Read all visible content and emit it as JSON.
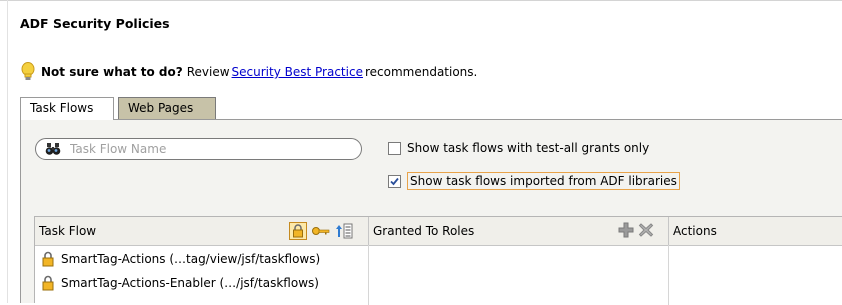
{
  "title": "ADF Security Policies",
  "hint": {
    "bold": "Not sure what to do?",
    "pre": "Review",
    "link": "Security Best Practice",
    "post": "recommendations.",
    "icon": "lightbulb-icon"
  },
  "tabs": [
    {
      "label": "Task Flows",
      "selected": true
    },
    {
      "label": "Web Pages",
      "selected": false
    }
  ],
  "search": {
    "placeholder": "Task Flow Name",
    "value": "",
    "icon": "binoculars-icon"
  },
  "checkboxes": [
    {
      "label": "Show task flows with test-all grants only",
      "checked": false
    },
    {
      "label": "Show task flows imported from ADF libraries",
      "checked": true
    }
  ],
  "table": {
    "columns": [
      "Task Flow",
      "Granted To Roles",
      "Actions"
    ],
    "header_icons_col1": [
      "lock-filter-icon",
      "key-filter-icon",
      "sort-icon"
    ],
    "header_icons_col2": [
      "add-icon",
      "delete-icon"
    ],
    "rows": [
      {
        "name": "SmartTag-Actions (…tag/view/jsf/taskflows)",
        "icon": "lock-icon"
      },
      {
        "name": "SmartTag-Actions-Enabler (…/jsf/taskflows)",
        "icon": "lock-icon"
      }
    ]
  },
  "colors": {
    "link": "#0000cc",
    "inactive_tab": "#c7c2a8",
    "panel": "#f3f3f0",
    "focus": "#e8a34a",
    "lock": "#f2b526"
  }
}
